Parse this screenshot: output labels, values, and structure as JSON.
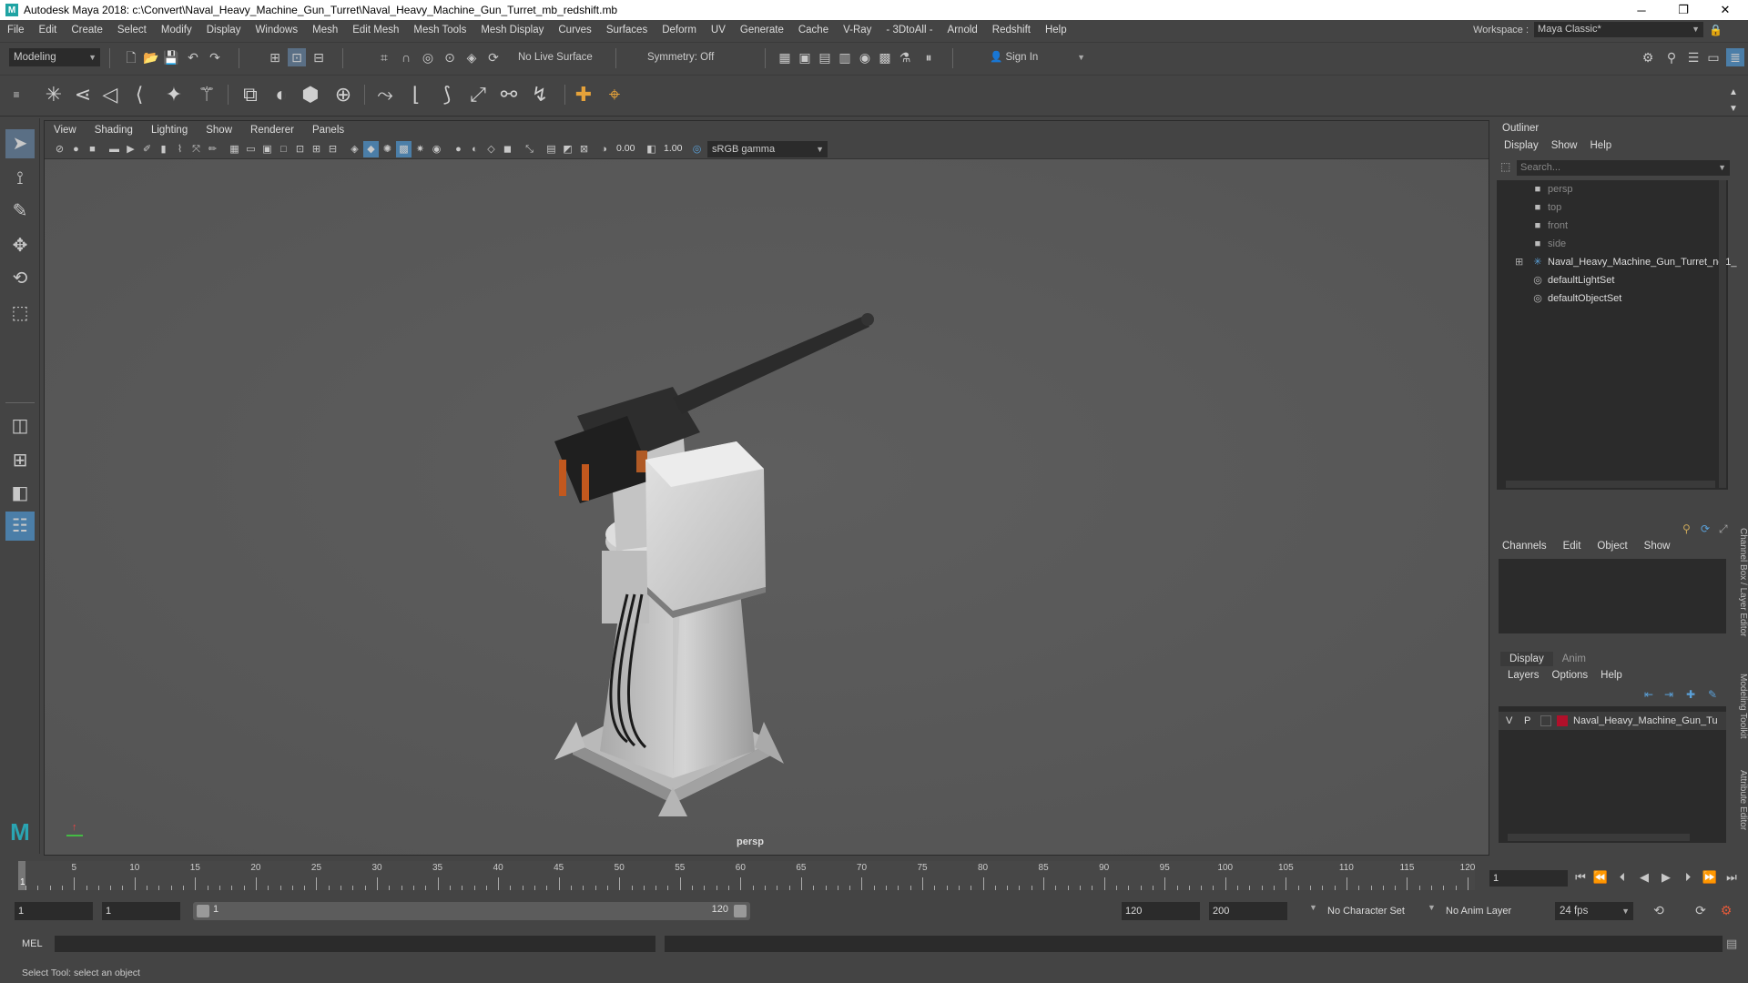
{
  "window": {
    "title": "Autodesk Maya 2018: c:\\Convert\\Naval_Heavy_Machine_Gun_Turret\\Naval_Heavy_Machine_Gun_Turret_mb_redshift.mb",
    "logo_letter": "M",
    "minimize": "─",
    "maximize": "❐",
    "close": "✕"
  },
  "menubar": {
    "items": [
      "File",
      "Edit",
      "Create",
      "Select",
      "Modify",
      "Display",
      "Windows",
      "Mesh",
      "Edit Mesh",
      "Mesh Tools",
      "Mesh Display",
      "Curves",
      "Surfaces",
      "Deform",
      "UV",
      "Generate",
      "Cache",
      "V-Ray",
      "- 3DtoAll -",
      "Arnold",
      "Redshift",
      "Help"
    ],
    "workspace_label": "Workspace :",
    "workspace_value": "Maya Classic*"
  },
  "statusline": {
    "mode": "Modeling",
    "live_surface": "No Live Surface",
    "symmetry": "Symmetry: Off",
    "sign_in": "Sign In"
  },
  "viewport": {
    "menu": [
      "View",
      "Shading",
      "Lighting",
      "Show",
      "Renderer",
      "Panels"
    ],
    "exposure": "0.00",
    "gamma": "1.00",
    "color_space": "sRGB gamma",
    "camera_label": "persp"
  },
  "outliner": {
    "title": "Outliner",
    "menu": [
      "Display",
      "Show",
      "Help"
    ],
    "search_placeholder": "Search...",
    "items": [
      {
        "label": "persp",
        "icon": "camera-icon",
        "dim": true
      },
      {
        "label": "top",
        "icon": "camera-icon",
        "dim": true
      },
      {
        "label": "front",
        "icon": "camera-icon",
        "dim": true
      },
      {
        "label": "side",
        "icon": "camera-icon",
        "dim": true
      },
      {
        "label": "Naval_Heavy_Machine_Gun_Turret_ncl1_",
        "icon": "group-icon",
        "dim": false
      },
      {
        "label": "defaultLightSet",
        "icon": "set-icon",
        "dim": false
      },
      {
        "label": "defaultObjectSet",
        "icon": "set-icon",
        "dim": false
      }
    ]
  },
  "channelbox": {
    "menu": [
      "Channels",
      "Edit",
      "Object",
      "Show"
    ]
  },
  "layereditor": {
    "tabs": [
      "Display",
      "Anim"
    ],
    "menu": [
      "Layers",
      "Options",
      "Help"
    ],
    "layer": {
      "v": "V",
      "p": "P",
      "name": "Naval_Heavy_Machine_Gun_Tu",
      "color": "#b0102a"
    }
  },
  "sidetabs": [
    "Channel Box / Layer Editor",
    "Modeling Toolkit",
    "Attribute Editor"
  ],
  "timeline": {
    "ticks": [
      "5",
      "10",
      "15",
      "20",
      "25",
      "30",
      "35",
      "40",
      "45",
      "50",
      "55",
      "60",
      "65",
      "70",
      "75",
      "80",
      "85",
      "90",
      "95",
      "100",
      "105",
      "110",
      "115",
      "120"
    ],
    "start_marker": "1",
    "current_frame": "1"
  },
  "range": {
    "start": "1",
    "anim_start": "1",
    "slider_start": "1",
    "slider_end": "120",
    "end": "120",
    "anim_end": "200",
    "character_set": "No Character Set",
    "anim_layer": "No Anim Layer",
    "fps": "24 fps"
  },
  "cmdline": {
    "label": "MEL"
  },
  "helpline": {
    "text": "Select Tool: select an object"
  },
  "colors": {
    "accent": "#5aa0d8",
    "layer_color": "#b0102a"
  }
}
